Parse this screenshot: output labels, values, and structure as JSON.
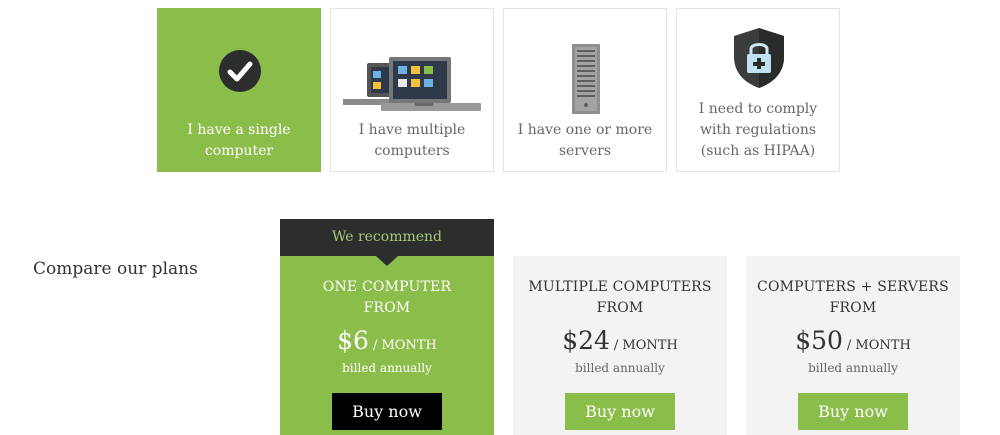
{
  "options": [
    {
      "label": "I have a single computer",
      "selected": true,
      "icon": "checkmark-circle-icon"
    },
    {
      "label": "I have multiple computers",
      "selected": false,
      "icon": "laptops-icon"
    },
    {
      "label": "I have one or more servers",
      "selected": false,
      "icon": "server-tower-icon"
    },
    {
      "label": "I need to comply with regulations (such as HIPAA)",
      "selected": false,
      "icon": "shield-lock-icon"
    }
  ],
  "compare_title": "Compare our plans",
  "recommend_label": "We recommend",
  "plans": [
    {
      "name": "ONE COMPUTER",
      "from": "FROM",
      "price": "$6",
      "per": "/ MONTH",
      "billed": "billed annually",
      "cta": "Buy now",
      "recommended": true
    },
    {
      "name": "MULTIPLE COMPUTERS",
      "from": "FROM",
      "price": "$24",
      "per": "/ MONTH",
      "billed": "billed annually",
      "cta": "Buy now",
      "recommended": false
    },
    {
      "name": "COMPUTERS + SERVERS",
      "from": "FROM",
      "price": "$50",
      "per": "/ MONTH",
      "billed": "billed annually",
      "cta": "Buy now",
      "recommended": false
    }
  ],
  "colors": {
    "accent": "#8bbd4a",
    "dark": "#2b2e2d",
    "card": "#f3f3f3"
  }
}
